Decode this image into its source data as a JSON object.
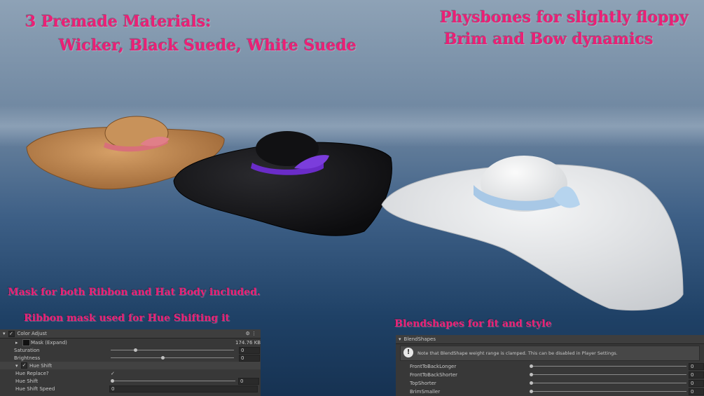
{
  "captions": {
    "premade_title": "3 Premade Materials:",
    "premade_list": "Wicker, Black Suede, White Suede",
    "physbones_line1": "Physbones for slightly floppy",
    "physbones_line2": "Brim and Bow dynamics",
    "mask_text": "Mask for both Ribbon and Hat Body included.",
    "ribbon_mask_text": "Ribbon mask used for Hue Shifting it",
    "blendshapes_text": "Blendshapes for fit and style"
  },
  "color_adjust_panel": {
    "title": "Color Adjust",
    "mask_label": "Mask (Expand)",
    "mask_size": "174.76 KB",
    "saturation_label": "Saturation",
    "saturation_value": "0",
    "saturation_level": 0.2,
    "brightness_label": "Brightness",
    "brightness_value": "0",
    "brightness_level": 0.42,
    "hue_shift_section": "Hue Shift",
    "hue_replace_label": "Hue Replace?",
    "hue_shift_label": "Hue Shift",
    "hue_shift_value": "0",
    "hue_shift_level": 0.0,
    "hue_shift_speed_label": "Hue Shift Speed",
    "hue_shift_speed_value": "0"
  },
  "blendshapes_panel": {
    "title": "BlendShapes",
    "notice": "Note that BlendShape weight range is clamped. This can be disabled in Player Settings.",
    "items": [
      {
        "label": "FrontToBackLonger",
        "value": "0"
      },
      {
        "label": "FrontToBackShorter",
        "value": "0"
      },
      {
        "label": "TopShorter",
        "value": "0"
      },
      {
        "label": "BrimSmaller",
        "value": "0"
      }
    ]
  },
  "colors": {
    "caption": "#ec1f76",
    "wicker": "#c48a52",
    "wicker_ribbon": "#d8707a",
    "black_hat": "#141416",
    "black_ribbon": "#6a2cc8",
    "white_hat": "#e6e8ea",
    "white_ribbon": "#a8c8e6"
  }
}
